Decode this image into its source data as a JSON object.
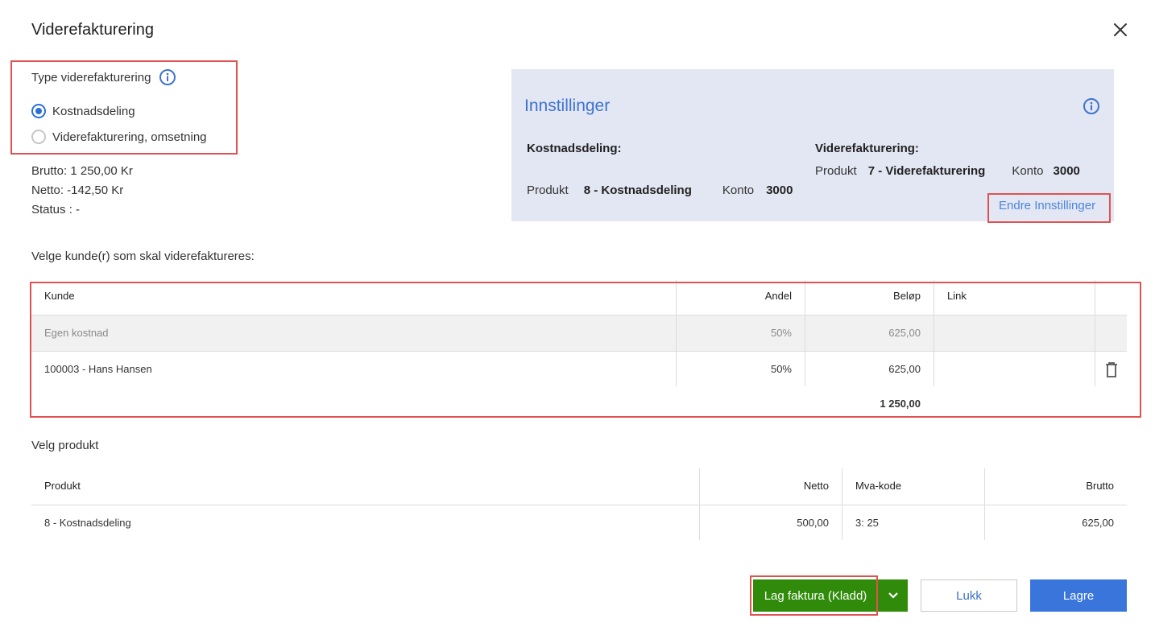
{
  "dialog": {
    "title": "Viderefakturering"
  },
  "type_section": {
    "label": "Type viderefakturering",
    "options": [
      {
        "label": "Kostnadsdeling",
        "selected": true
      },
      {
        "label": "Viderefakturering, omsetning",
        "selected": false
      }
    ]
  },
  "summary": {
    "brutto": "Brutto: 1 250,00 Kr",
    "netto": "Netto: -142,50 Kr",
    "status": "Status : -"
  },
  "settings": {
    "title": "Innstillinger",
    "kostnadsdeling": {
      "heading": "Kostnadsdeling:",
      "produkt_label": "Produkt",
      "produkt_value": "8 - Kostnadsdeling",
      "konto_label": "Konto",
      "konto_value": "3000"
    },
    "viderefakturering": {
      "heading": "Viderefakturering:",
      "produkt_label": "Produkt",
      "produkt_value": "7 - Viderefakturering",
      "konto_label": "Konto",
      "konto_value": "3000"
    },
    "edit_link": "Endre Innstillinger"
  },
  "customers": {
    "label": "Velge kunde(r) som skal viderefaktureres:",
    "columns": {
      "kunde": "Kunde",
      "andel": "Andel",
      "belop": "Beløp",
      "link": "Link"
    },
    "rows": [
      {
        "kunde": "Egen kostnad",
        "andel": "50%",
        "belop": "625,00",
        "link": ""
      },
      {
        "kunde": "100003 - Hans Hansen",
        "andel": "50%",
        "belop": "625,00",
        "link": ""
      }
    ],
    "total": "1 250,00"
  },
  "products": {
    "label": "Velg produkt",
    "columns": {
      "produkt": "Produkt",
      "netto": "Netto",
      "mva": "Mva-kode",
      "brutto": "Brutto"
    },
    "rows": [
      {
        "produkt": "8 - Kostnadsdeling",
        "netto": "500,00",
        "mva": "3: 25",
        "brutto": "625,00"
      }
    ]
  },
  "buttons": {
    "create_invoice": "Lag faktura (Kladd)",
    "close": "Lukk",
    "save": "Lagre"
  },
  "colors": {
    "accent_blue": "#3a75db",
    "green": "#2f8b09",
    "highlight_red": "#e05252",
    "settings_bg": "#e3e6f3"
  }
}
